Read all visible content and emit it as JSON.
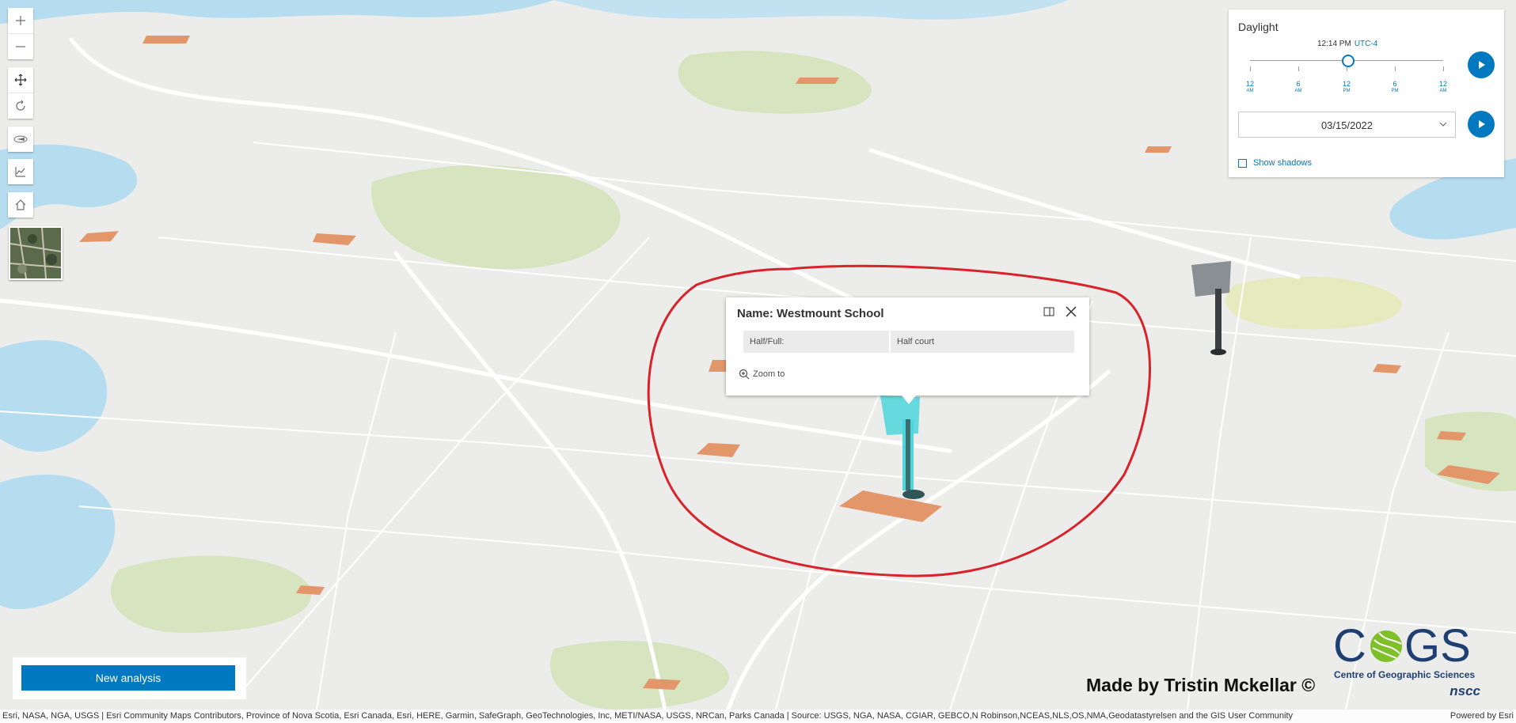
{
  "toolbar": {
    "zoom_in": "zoom-in",
    "zoom_out": "zoom-out",
    "pan": "pan",
    "rotate": "rotate",
    "navigate": "compass",
    "elevation": "elevation-profile",
    "home": "home"
  },
  "daylight": {
    "title": "Daylight",
    "time": "12:14 PM",
    "timezone": "UTC-4",
    "time_fraction": 0.51,
    "ticks": [
      {
        "value": "12",
        "unit": "AM"
      },
      {
        "value": "6",
        "unit": "AM"
      },
      {
        "value": "12",
        "unit": "PM"
      },
      {
        "value": "6",
        "unit": "PM"
      },
      {
        "value": "12",
        "unit": "AM"
      }
    ],
    "date": "03/15/2022",
    "show_shadows_label": "Show shadows",
    "show_shadows": false
  },
  "popup": {
    "title": "Name: Westmount School",
    "fields": [
      {
        "label": "Half/Full:",
        "value": "Half court"
      }
    ],
    "zoom_to": "Zoom to"
  },
  "analysis": {
    "button_label": "New analysis"
  },
  "credit": {
    "made_by": "Made by Tristin Mckellar ©",
    "logo_text": "COGS",
    "org_name": "Centre of Geographic Sciences",
    "sub_org": "nscc"
  },
  "attribution": {
    "sources": "Esri, NASA, NGA, USGS | Esri Community Maps Contributors, Province of Nova Scotia, Esri Canada, Esri, HERE, Garmin, SafeGraph, GeoTechnologies, Inc, METI/NASA, USGS, NRCan, Parks Canada | Source: USGS, NGA, NASA, CGIAR, GEBCO,N Robinson,NCEAS,NLS,OS,NMA,Geodatastyrelsen and the GIS User Community",
    "powered_by": "Powered by Esri"
  },
  "colors": {
    "accent": "#0079c1",
    "water": "#b5dcef",
    "park": "#d6e5bf",
    "field": "#e2966a",
    "highlight": "#4fd6dc",
    "sketch": "#d9232a"
  }
}
